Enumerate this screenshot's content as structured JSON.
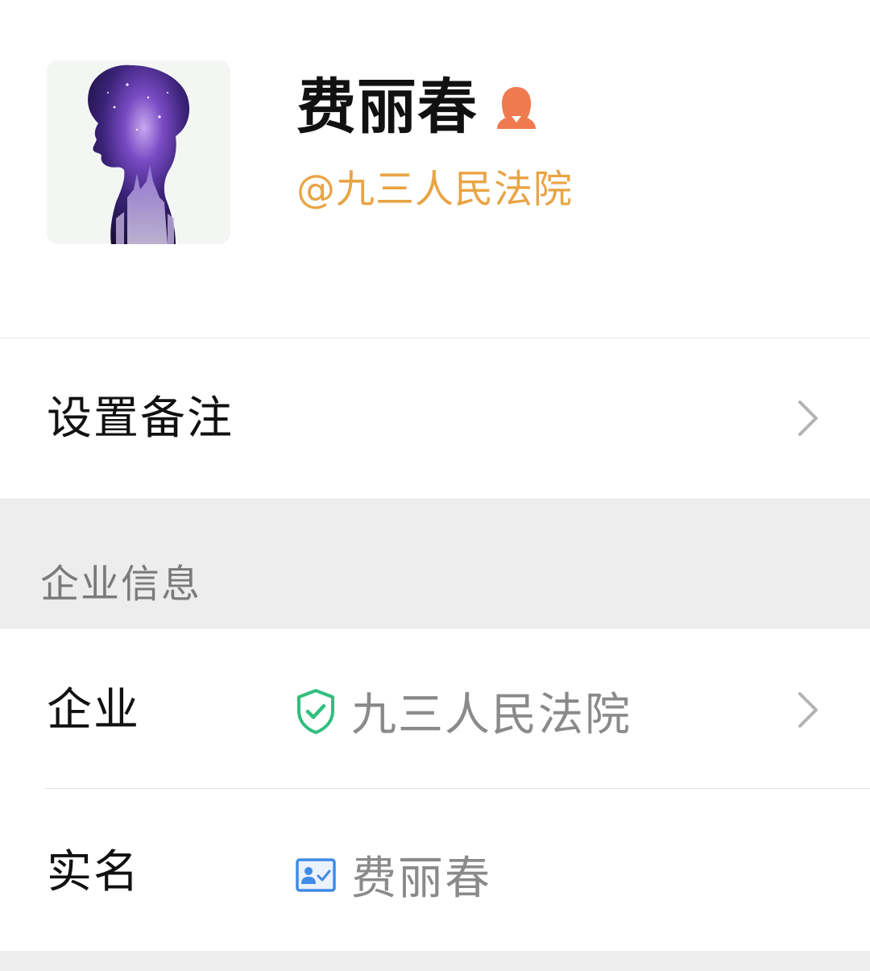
{
  "profile": {
    "name": "费丽春",
    "gender_icon": "female-user-icon",
    "org_handle": "@九三人民法院",
    "org_handle_color": "#e9a445",
    "gender_icon_color": "#f07a4f"
  },
  "remark": {
    "label": "设置备注"
  },
  "section": {
    "title": "企业信息"
  },
  "company": {
    "label": "企业",
    "icon": "verified-shield-icon",
    "icon_color": "#2fbf7d",
    "value": "九三人民法院"
  },
  "realname": {
    "label": "实名",
    "icon": "id-card-icon",
    "icon_color": "#3f8be6",
    "value": "费丽春"
  }
}
